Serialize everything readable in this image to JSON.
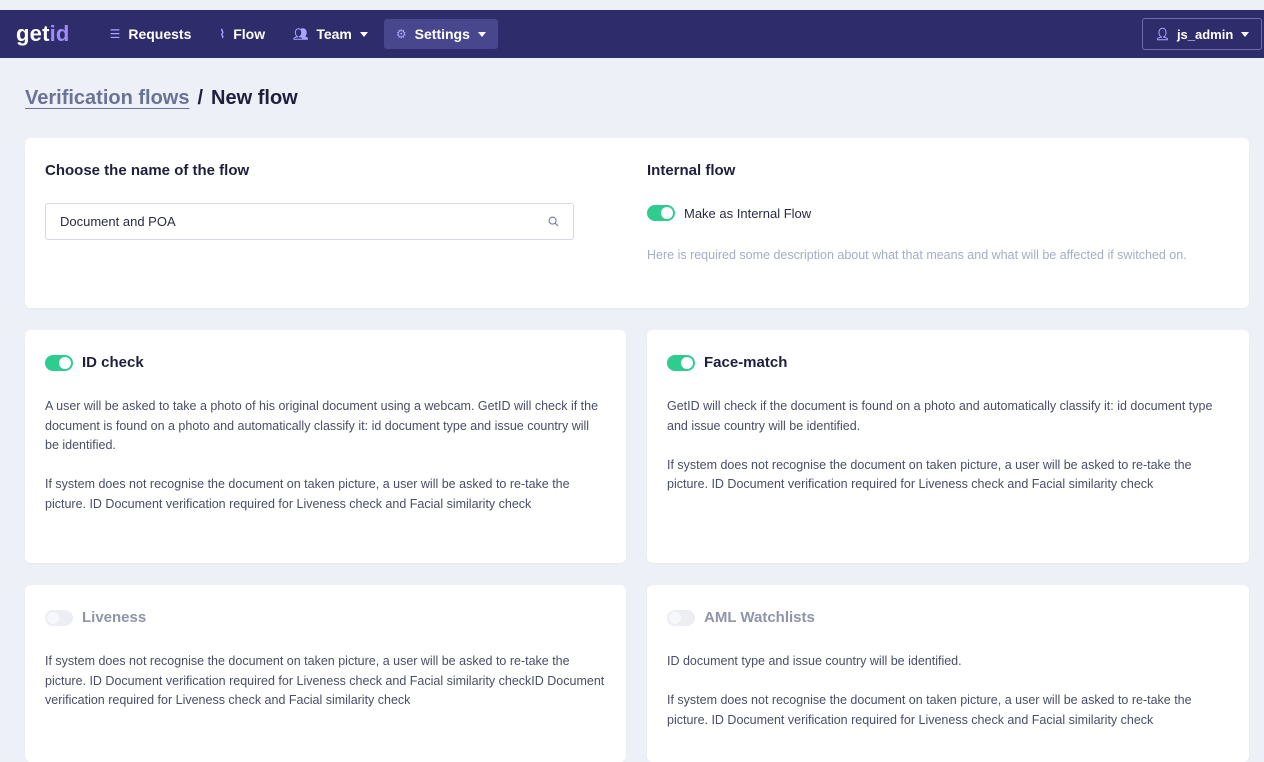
{
  "brand": {
    "logo_main": "get",
    "logo_accent": "id"
  },
  "nav": {
    "items": [
      {
        "label": "Requests",
        "icon": "list-icon"
      },
      {
        "label": "Flow",
        "icon": "flow-icon"
      },
      {
        "label": "Team",
        "icon": "users-icon",
        "dropdown": true
      },
      {
        "label": "Settings",
        "icon": "gear-icon",
        "dropdown": true,
        "active": true
      }
    ],
    "user": {
      "label": "js_admin",
      "icon": "user-icon"
    }
  },
  "breadcrumb": {
    "parent": "Verification flows",
    "separator": "/",
    "current": "New flow"
  },
  "flow_name": {
    "title": "Choose the name of the flow",
    "value": "Document and POA"
  },
  "internal_flow": {
    "title": "Internal flow",
    "toggle_label": "Make as Internal Flow",
    "toggle_on": true,
    "description": "Here is required some description about what that means and what will be affected if switched on."
  },
  "features": [
    {
      "title": "ID check",
      "enabled": true,
      "paragraphs": [
        "A user will be asked to take a photo of his original document using a webcam. GetID will check if the document is found on a photo and automatically classify it: id document type and issue country will be identified.",
        "If system does not recognise the document on taken picture, a user will be asked to re-take the picture. ID Document verification required for Liveness check and Facial similarity check"
      ]
    },
    {
      "title": "Face-match",
      "enabled": true,
      "paragraphs": [
        "GetID will check if the document is found on a photo and automatically classify it: id document type and issue country will be identified.",
        "If system does not recognise the document on taken picture, a user will be asked to re-take the picture. ID Document verification required for Liveness check and Facial similarity check"
      ]
    },
    {
      "title": "Liveness",
      "enabled": false,
      "paragraphs": [
        "If system does not recognise the document on taken picture, a user will be asked to re-take the picture. ID Document verification required for Liveness check and Facial similarity checkID Document verification required for Liveness check and Facial similarity check"
      ]
    },
    {
      "title": "AML Watchlists",
      "enabled": false,
      "paragraphs": [
        "ID document type and issue country will be identified.",
        "If system does not recognise the document on taken picture, a user will be asked to re-take the picture. ID Document verification required for Liveness check and Facial similarity check"
      ]
    }
  ],
  "colors": {
    "topbar": "#2e2c6b",
    "toggle_on": "#2ecc8e",
    "accent": "#9f8cf6",
    "background": "#eef0f7"
  }
}
